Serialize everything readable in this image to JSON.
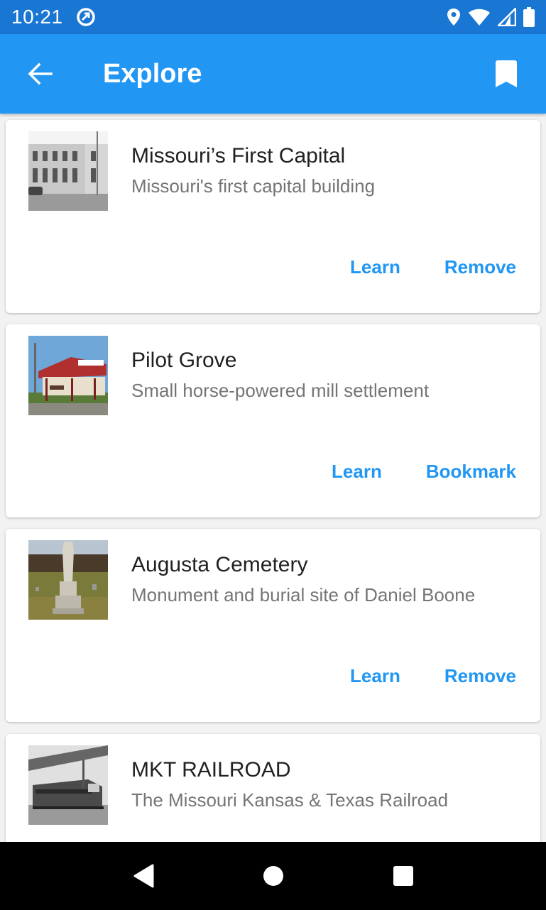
{
  "status_bar": {
    "time": "10:21"
  },
  "app_bar": {
    "title": "Explore"
  },
  "places": [
    {
      "title": "Missouri’s First Capital",
      "subtitle": "Missouri's first capital building",
      "actions": [
        "Learn",
        "Remove"
      ]
    },
    {
      "title": "Pilot Grove",
      "subtitle": "Small horse-powered mill settlement",
      "actions": [
        "Learn",
        "Bookmark"
      ]
    },
    {
      "title": "Augusta Cemetery",
      "subtitle": "Monument and burial site of Daniel Boone",
      "actions": [
        "Learn",
        "Remove"
      ]
    },
    {
      "title": "MKT RAILROAD",
      "subtitle": "The Missouri Kansas & Texas Railroad",
      "actions": []
    }
  ],
  "colors": {
    "status_bar": "#1976d2",
    "app_bar": "#2196f3",
    "accent": "#2196f3"
  },
  "icons": {
    "back": "arrow-back-icon",
    "bookmark": "bookmark-icon",
    "nav_back": "triangle-back-icon",
    "nav_home": "circle-home-icon",
    "nav_recents": "square-recents-icon"
  }
}
